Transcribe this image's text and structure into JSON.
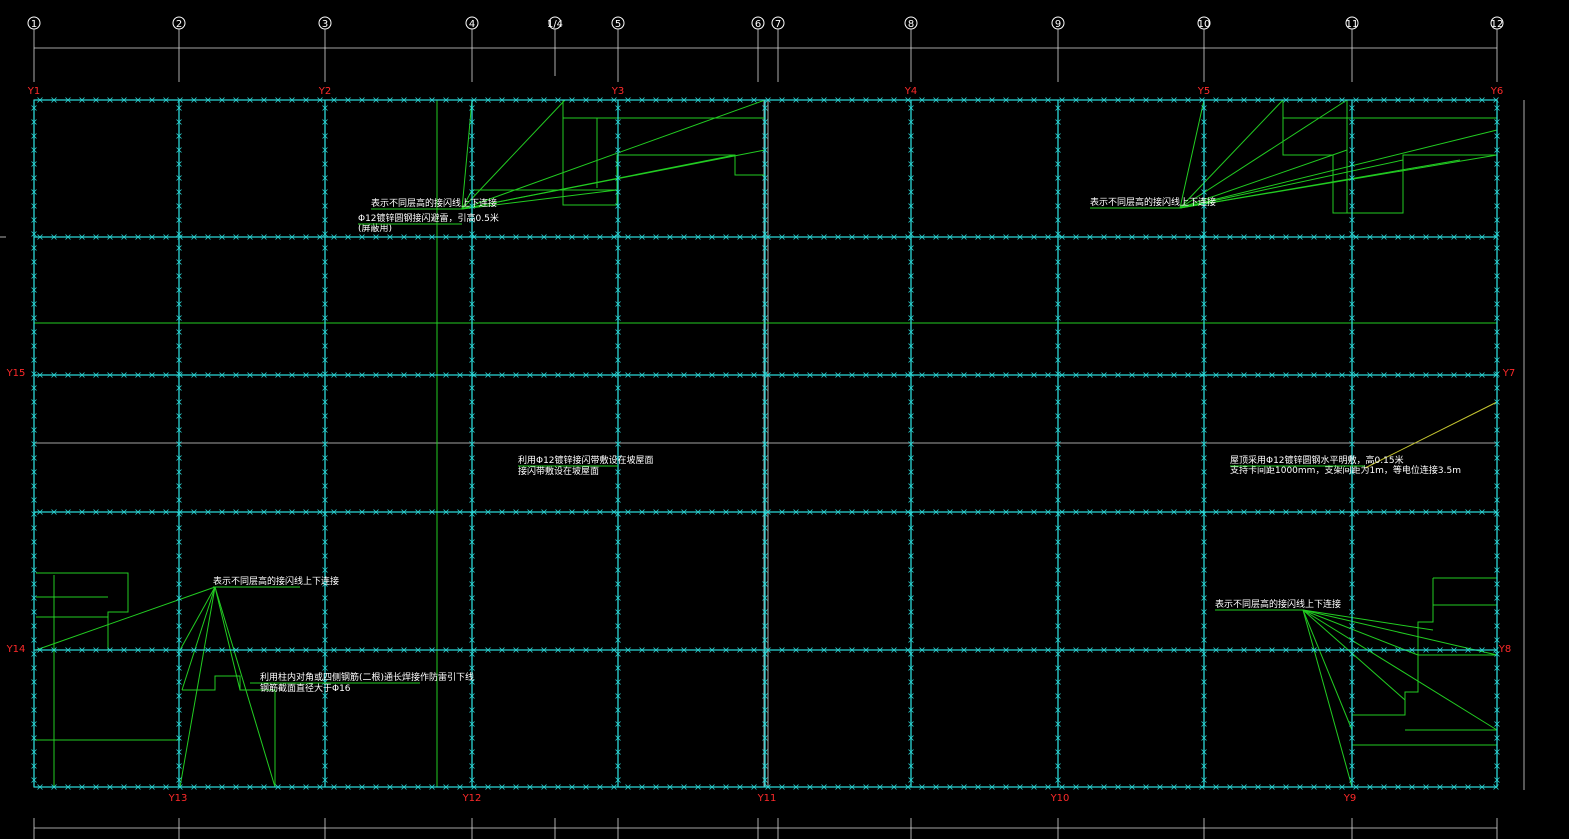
{
  "axes": {
    "top": [
      "1",
      "2",
      "3",
      "4",
      "1/4",
      "5",
      "6",
      "7",
      "8",
      "9",
      "10",
      "11",
      "12"
    ]
  },
  "y_labels": {
    "corners": [
      "Y1",
      "Y2",
      "Y3",
      "Y4",
      "Y5",
      "Y6",
      "Y7",
      "Y8",
      "Y9",
      "Y10",
      "Y11",
      "Y12",
      "Y13",
      "Y14",
      "Y15"
    ]
  },
  "notes": {
    "n1": "表示不同层高的接闪线上下连接",
    "n2": "Φ12镀锌圆钢接闪避雷，引高0.5米",
    "n2b": "(屏蔽用)",
    "n3": "表示不同层高的接闪线上下连接",
    "n4": "利用Φ12镀锌接闪带敷设在坡屋面",
    "n4b": "接闪带敷设在坡屋面",
    "n5": "屋顶采用Φ12镀锌圆钢水平明敷，高0.15米",
    "n5b": "支持卡间距1000mm，支架间距为1m，等电位连接3.5m",
    "n6": "表示不同层高的接闪线上下连接",
    "n7": "利用柱内对角或四侧钢筋(二根)通长焊接作防雷引下线",
    "n7b": "钢筋截面直径大于Φ16",
    "n8": "表示不同层高的接闪线上下连接"
  }
}
